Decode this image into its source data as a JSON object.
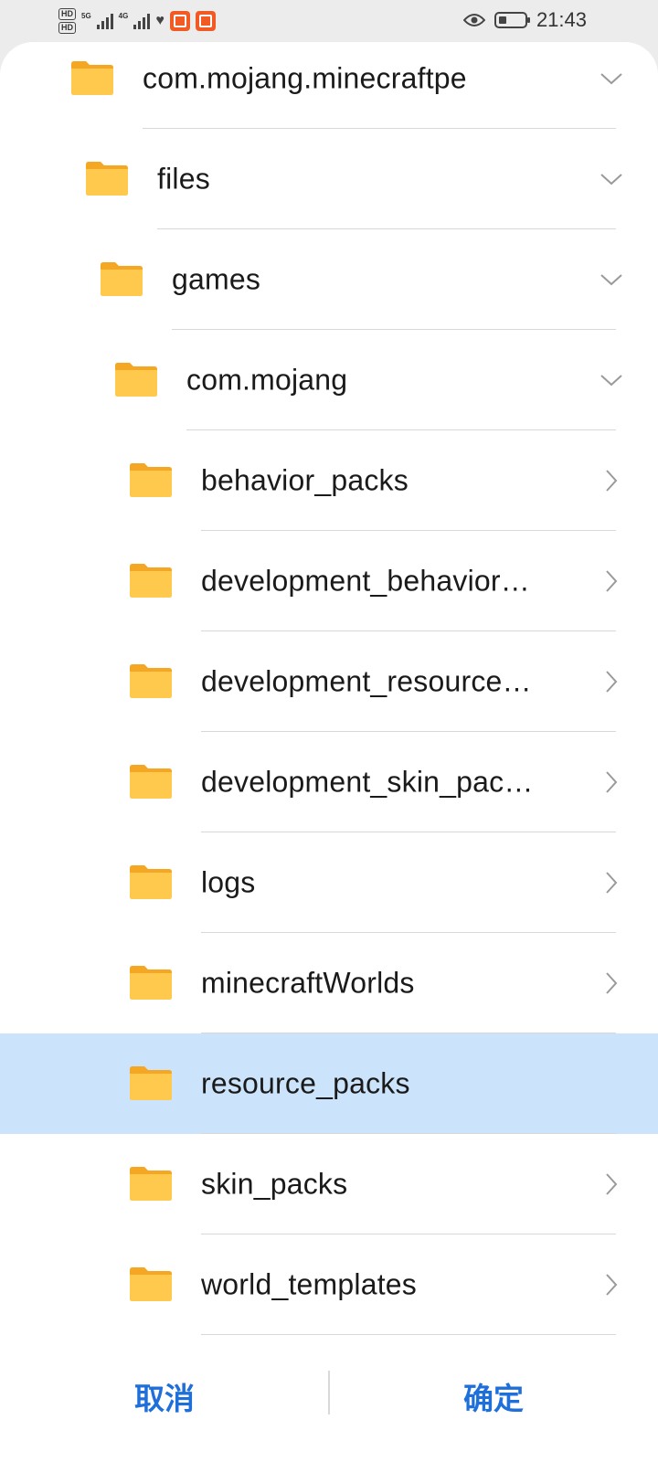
{
  "status_bar": {
    "hd1": "HD",
    "hd2": "HD",
    "net1": "5G",
    "net2": "4G",
    "time": "21:43",
    "battery_level": 0.3
  },
  "folders": [
    {
      "label": "com.mojang.minecraftpe",
      "chevron": "chevron-down"
    },
    {
      "label": "files",
      "chevron": "chevron-down"
    },
    {
      "label": "games",
      "chevron": "chevron-down"
    },
    {
      "label": "com.mojang",
      "chevron": "chevron-down"
    },
    {
      "label": "behavior_packs",
      "chevron": "chevron-right"
    },
    {
      "label": "development_behavior…",
      "chevron": "chevron-right"
    },
    {
      "label": "development_resource…",
      "chevron": "chevron-right"
    },
    {
      "label": "development_skin_pac…",
      "chevron": "chevron-right"
    },
    {
      "label": "logs",
      "chevron": "chevron-right"
    },
    {
      "label": "minecraftWorlds",
      "chevron": "chevron-right"
    },
    {
      "label": "resource_packs",
      "chevron": "none",
      "selected": true
    },
    {
      "label": "skin_packs",
      "chevron": "chevron-right"
    },
    {
      "label": "world_templates",
      "chevron": "chevron-right"
    }
  ],
  "footer": {
    "cancel_label": "取消",
    "confirm_label": "确定"
  },
  "colors": {
    "accent": "#1e6fd9",
    "folder": "#ffc94d",
    "selected_bg": "#cce4fb"
  }
}
